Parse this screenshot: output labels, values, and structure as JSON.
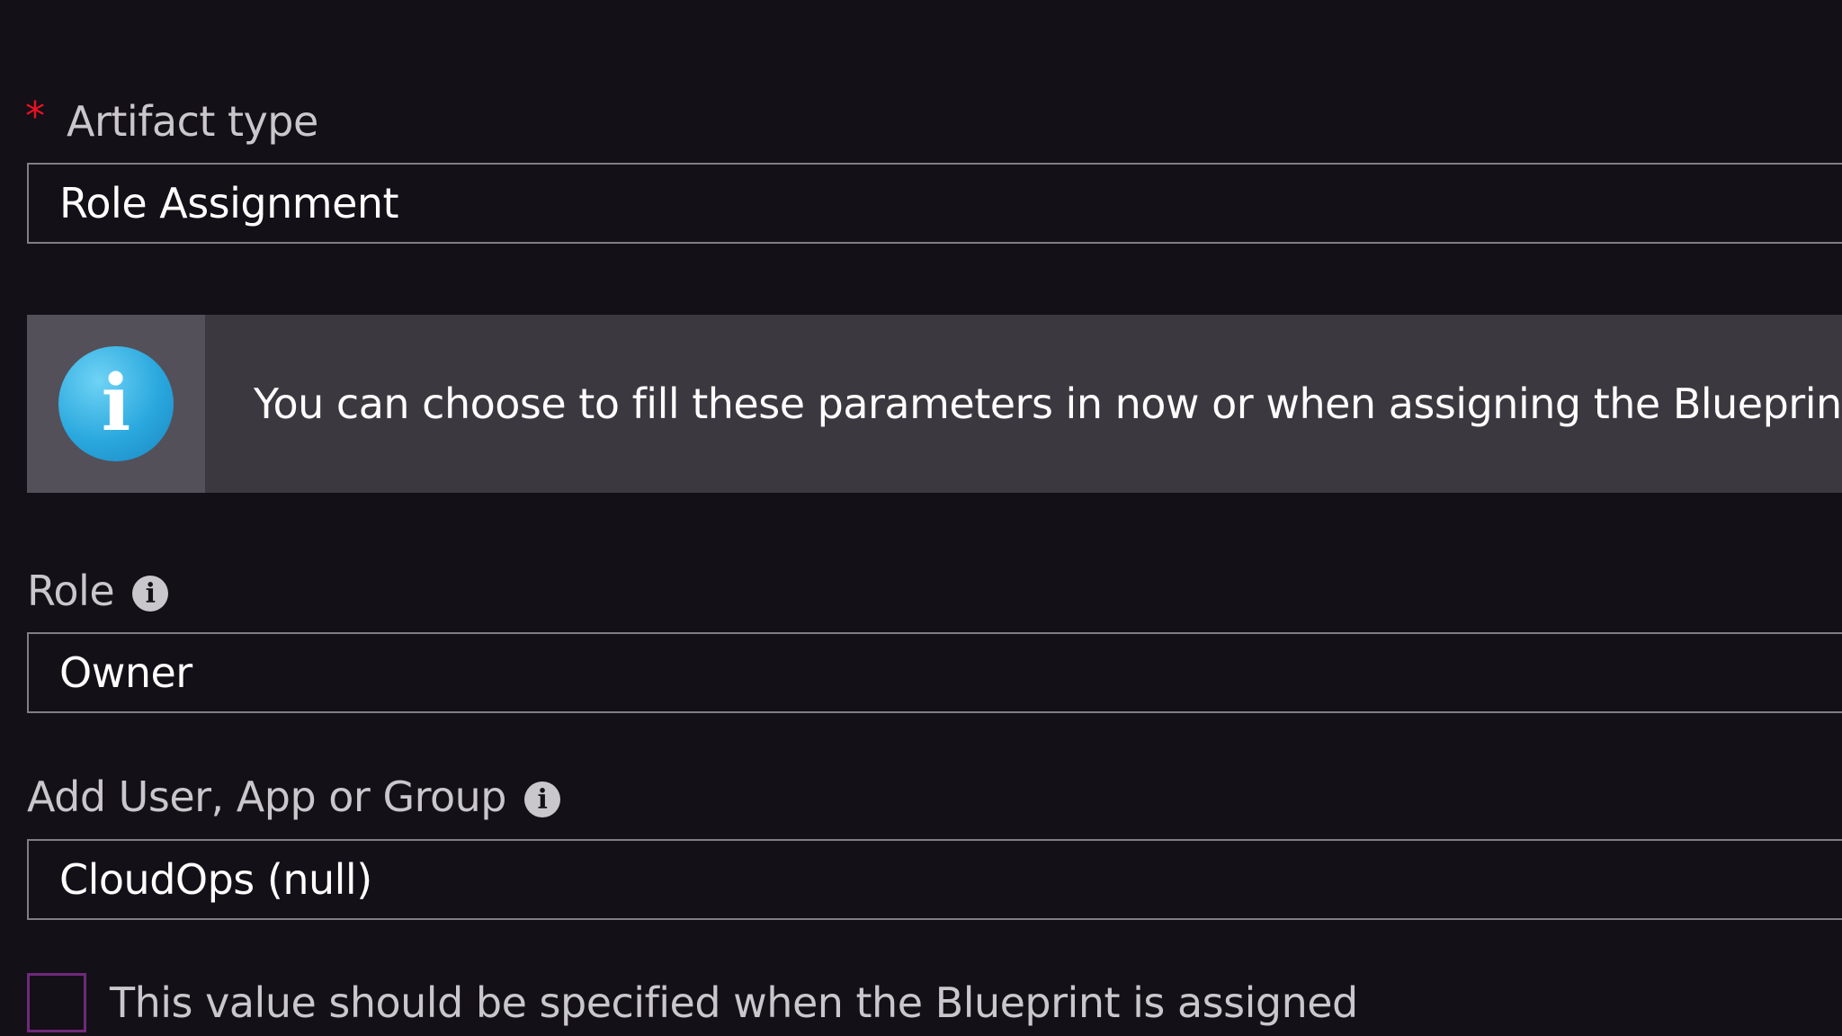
{
  "artifact_type": {
    "label": "Artifact type",
    "required_marker": "*",
    "value": "Role Assignment"
  },
  "info_banner": {
    "icon": "info-icon",
    "icon_glyph": "i",
    "text": "You can choose to fill these parameters in now or when assigning the Blueprint."
  },
  "role": {
    "label": "Role",
    "info_icon_glyph": "i",
    "value": "Owner"
  },
  "principal": {
    "label": "Add User, App or Group",
    "info_icon_glyph": "i",
    "value": "CloudOps (null)"
  },
  "assign_later": {
    "checked": false,
    "label": "This value should be specified when the Blueprint is assigned"
  },
  "colors": {
    "background": "#141017",
    "banner": "#3b383f",
    "required": "#e81123",
    "info_blue": "#2aa8de",
    "checkbox_border": "#6e2a7a"
  }
}
